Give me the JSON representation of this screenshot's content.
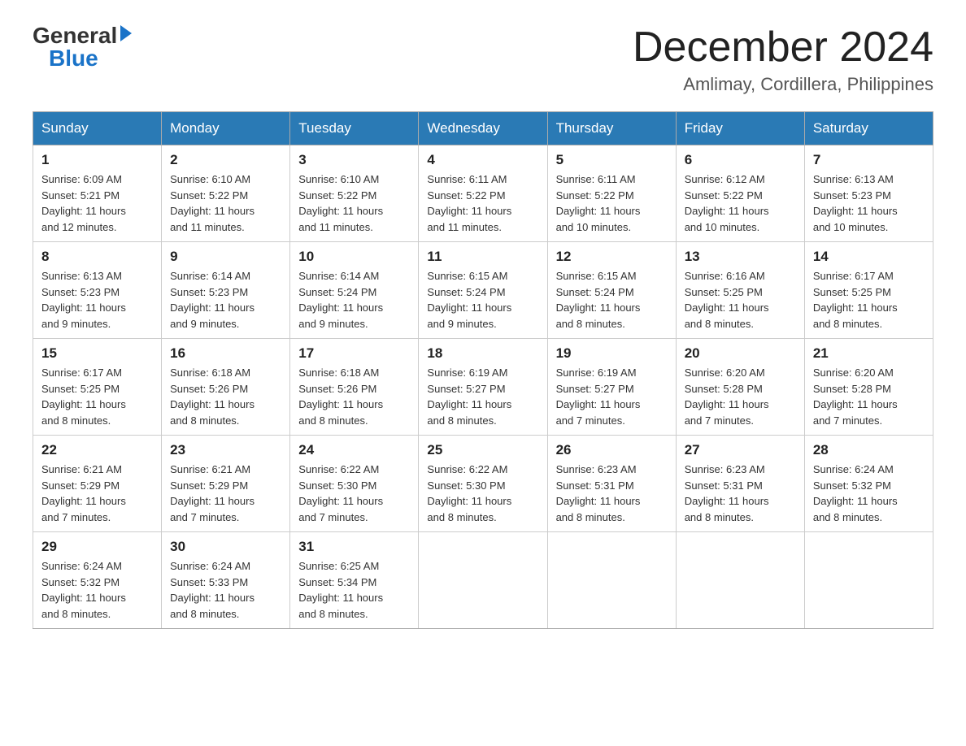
{
  "header": {
    "logo_general": "General",
    "logo_blue": "Blue",
    "month_title": "December 2024",
    "location": "Amlimay, Cordillera, Philippines"
  },
  "days_of_week": [
    "Sunday",
    "Monday",
    "Tuesday",
    "Wednesday",
    "Thursday",
    "Friday",
    "Saturday"
  ],
  "weeks": [
    [
      {
        "day": "1",
        "sunrise": "6:09 AM",
        "sunset": "5:21 PM",
        "daylight": "11 hours and 12 minutes."
      },
      {
        "day": "2",
        "sunrise": "6:10 AM",
        "sunset": "5:22 PM",
        "daylight": "11 hours and 11 minutes."
      },
      {
        "day": "3",
        "sunrise": "6:10 AM",
        "sunset": "5:22 PM",
        "daylight": "11 hours and 11 minutes."
      },
      {
        "day": "4",
        "sunrise": "6:11 AM",
        "sunset": "5:22 PM",
        "daylight": "11 hours and 11 minutes."
      },
      {
        "day": "5",
        "sunrise": "6:11 AM",
        "sunset": "5:22 PM",
        "daylight": "11 hours and 10 minutes."
      },
      {
        "day": "6",
        "sunrise": "6:12 AM",
        "sunset": "5:22 PM",
        "daylight": "11 hours and 10 minutes."
      },
      {
        "day": "7",
        "sunrise": "6:13 AM",
        "sunset": "5:23 PM",
        "daylight": "11 hours and 10 minutes."
      }
    ],
    [
      {
        "day": "8",
        "sunrise": "6:13 AM",
        "sunset": "5:23 PM",
        "daylight": "11 hours and 9 minutes."
      },
      {
        "day": "9",
        "sunrise": "6:14 AM",
        "sunset": "5:23 PM",
        "daylight": "11 hours and 9 minutes."
      },
      {
        "day": "10",
        "sunrise": "6:14 AM",
        "sunset": "5:24 PM",
        "daylight": "11 hours and 9 minutes."
      },
      {
        "day": "11",
        "sunrise": "6:15 AM",
        "sunset": "5:24 PM",
        "daylight": "11 hours and 9 minutes."
      },
      {
        "day": "12",
        "sunrise": "6:15 AM",
        "sunset": "5:24 PM",
        "daylight": "11 hours and 8 minutes."
      },
      {
        "day": "13",
        "sunrise": "6:16 AM",
        "sunset": "5:25 PM",
        "daylight": "11 hours and 8 minutes."
      },
      {
        "day": "14",
        "sunrise": "6:17 AM",
        "sunset": "5:25 PM",
        "daylight": "11 hours and 8 minutes."
      }
    ],
    [
      {
        "day": "15",
        "sunrise": "6:17 AM",
        "sunset": "5:25 PM",
        "daylight": "11 hours and 8 minutes."
      },
      {
        "day": "16",
        "sunrise": "6:18 AM",
        "sunset": "5:26 PM",
        "daylight": "11 hours and 8 minutes."
      },
      {
        "day": "17",
        "sunrise": "6:18 AM",
        "sunset": "5:26 PM",
        "daylight": "11 hours and 8 minutes."
      },
      {
        "day": "18",
        "sunrise": "6:19 AM",
        "sunset": "5:27 PM",
        "daylight": "11 hours and 8 minutes."
      },
      {
        "day": "19",
        "sunrise": "6:19 AM",
        "sunset": "5:27 PM",
        "daylight": "11 hours and 7 minutes."
      },
      {
        "day": "20",
        "sunrise": "6:20 AM",
        "sunset": "5:28 PM",
        "daylight": "11 hours and 7 minutes."
      },
      {
        "day": "21",
        "sunrise": "6:20 AM",
        "sunset": "5:28 PM",
        "daylight": "11 hours and 7 minutes."
      }
    ],
    [
      {
        "day": "22",
        "sunrise": "6:21 AM",
        "sunset": "5:29 PM",
        "daylight": "11 hours and 7 minutes."
      },
      {
        "day": "23",
        "sunrise": "6:21 AM",
        "sunset": "5:29 PM",
        "daylight": "11 hours and 7 minutes."
      },
      {
        "day": "24",
        "sunrise": "6:22 AM",
        "sunset": "5:30 PM",
        "daylight": "11 hours and 7 minutes."
      },
      {
        "day": "25",
        "sunrise": "6:22 AM",
        "sunset": "5:30 PM",
        "daylight": "11 hours and 8 minutes."
      },
      {
        "day": "26",
        "sunrise": "6:23 AM",
        "sunset": "5:31 PM",
        "daylight": "11 hours and 8 minutes."
      },
      {
        "day": "27",
        "sunrise": "6:23 AM",
        "sunset": "5:31 PM",
        "daylight": "11 hours and 8 minutes."
      },
      {
        "day": "28",
        "sunrise": "6:24 AM",
        "sunset": "5:32 PM",
        "daylight": "11 hours and 8 minutes."
      }
    ],
    [
      {
        "day": "29",
        "sunrise": "6:24 AM",
        "sunset": "5:32 PM",
        "daylight": "11 hours and 8 minutes."
      },
      {
        "day": "30",
        "sunrise": "6:24 AM",
        "sunset": "5:33 PM",
        "daylight": "11 hours and 8 minutes."
      },
      {
        "day": "31",
        "sunrise": "6:25 AM",
        "sunset": "5:34 PM",
        "daylight": "11 hours and 8 minutes."
      },
      null,
      null,
      null,
      null
    ]
  ],
  "labels": {
    "sunrise": "Sunrise:",
    "sunset": "Sunset:",
    "daylight": "Daylight:"
  }
}
